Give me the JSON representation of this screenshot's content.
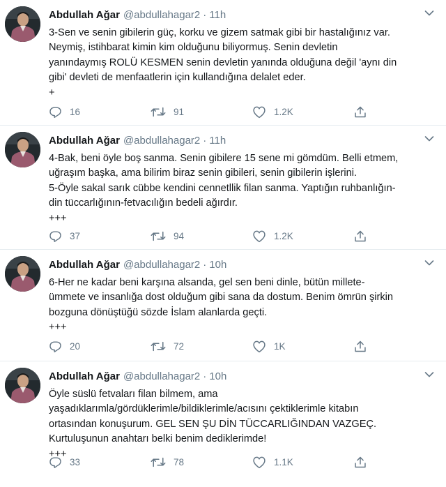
{
  "tweets": [
    {
      "name": "Abdullah Ağar",
      "handle": "@abdullahagar2",
      "separator": "·",
      "time": "11h",
      "text": "3-Sen ve senin gibilerin güç, korku ve gizem satmak gibi bir hastalığınız var.\nNeymiş, istihbarat kimin kim olduğunu biliyormuş. Senin devletin\nyanındaymış ROLÜ KESMEN senin devletin yanında olduğuna değil 'aynı din\ngibi' devleti de menfaatlerin için kullandığına delalet eder.\n+",
      "replies": "16",
      "retweets": "91",
      "likes": "1.2K"
    },
    {
      "name": "Abdullah Ağar",
      "handle": "@abdullahagar2",
      "separator": "·",
      "time": "11h",
      "text": "4-Bak, beni öyle boş sanma. Senin gibilere 15 sene mi gömdüm. Belli etmem,\nuğraşım başka, ama bilirim biraz senin gibileri, senin gibilerin işlerini.\n5-Öyle sakal sarık cübbe kendini cennetllik filan sanma. Yaptığın ruhbanlığın-\ndin tüccarlığının-fetvacılığın bedeli ağırdır.\n+++",
      "replies": "37",
      "retweets": "94",
      "likes": "1.2K"
    },
    {
      "name": "Abdullah Ağar",
      "handle": "@abdullahagar2",
      "separator": "·",
      "time": "10h",
      "text": "6-Her ne kadar beni karşına alsanda, gel sen beni dinle, bütün millete-\nümmete ve insanlığa dost olduğum gibi sana da dostum. Benim ömrün şirkin\nbozguna dönüştüğü sözde İslam alanlarda geçti.\n+++",
      "replies": "20",
      "retweets": "72",
      "likes": "1K"
    },
    {
      "name": "Abdullah Ağar",
      "handle": "@abdullahagar2",
      "separator": "·",
      "time": "10h",
      "text": "Öyle süslü fetvaları filan bilmem, ama\nyaşadıklarımla/gördüklerimle/bildiklerimle/acısını çektiklerimle kitabın\nortasından konuşurum. GEL SEN ŞU DİN TÜCCARLIĞINDAN VAZGEÇ.\nKurtuluşunun anahtarı belki benim dediklerimde!\n+++",
      "replies": "33",
      "retweets": "78",
      "likes": "1.1K"
    }
  ],
  "icons": {
    "reply": "reply-icon",
    "retweet": "retweet-icon",
    "like": "heart-icon",
    "share": "share-icon",
    "menu": "chevron-down-icon"
  },
  "colors": {
    "text": "#14171a",
    "muted": "#657786",
    "divider": "#e6ecf0"
  }
}
